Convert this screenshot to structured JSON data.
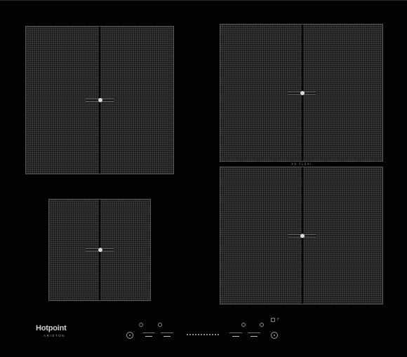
{
  "cooktop": {
    "brand": {
      "name": "Hotpoint",
      "sub": "ARISTON"
    },
    "zones": [
      {
        "id": "front-left"
      },
      {
        "id": "rear-left"
      },
      {
        "id": "rear-right"
      },
      {
        "id": "front-right"
      }
    ],
    "flexi_label": "XX FLEXI",
    "controls": {
      "lock_label": "F"
    }
  },
  "colors": {
    "glass": "#020203",
    "zone_fill": "#3a3a3a",
    "zone_mesh": "#0d0d0d",
    "indicator": "#d8d8d8"
  },
  "icons": [
    "power-icon",
    "timer-icon",
    "minus-icon",
    "plus-icon",
    "lock-icon"
  ]
}
